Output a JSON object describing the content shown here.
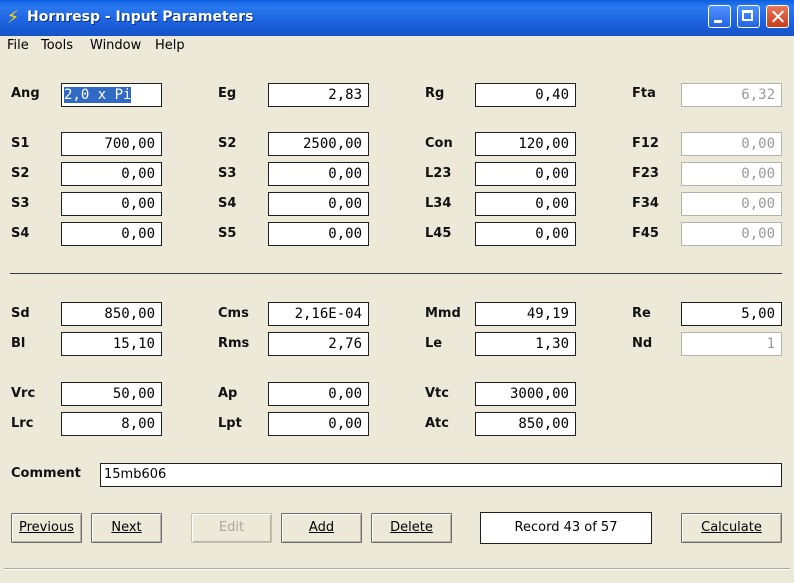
{
  "window": {
    "title": "Hornresp - Input Parameters"
  },
  "menu": [
    "File",
    "Tools",
    "Window",
    "Help"
  ],
  "fields": {
    "Ang": "2,0 x Pi",
    "Eg": "2,83",
    "Rg": "0,40",
    "Fta": "6,32",
    "S1": "700,00",
    "S2a": "2500,00",
    "Con": "120,00",
    "F12": "0,00",
    "S2": "0,00",
    "S3a": "0,00",
    "L23": "0,00",
    "F23": "0,00",
    "S3": "0,00",
    "S4a": "0,00",
    "L34": "0,00",
    "F34": "0,00",
    "S4": "0,00",
    "S5": "0,00",
    "L45": "0,00",
    "F45": "0,00",
    "Sd": "850,00",
    "Cms": "2,16E-04",
    "Mmd": "49,19",
    "Re": "5,00",
    "Bl": "15,10",
    "Rms": "2,76",
    "Le": "1,30",
    "Nd": "1",
    "Vrc": "50,00",
    "Ap": "0,00",
    "Vtc": "3000,00",
    "Lrc": "8,00",
    "Lpt": "0,00",
    "Atc": "850,00"
  },
  "labels": {
    "Ang": "Ang",
    "Eg": "Eg",
    "Rg": "Rg",
    "Fta": "Fta",
    "S1": "S1",
    "S2a": "S2",
    "Con": "Con",
    "F12": "F12",
    "S2": "S2",
    "S3a": "S3",
    "L23": "L23",
    "F23": "F23",
    "S3": "S3",
    "S4a": "S4",
    "L34": "L34",
    "F34": "F34",
    "S4": "S4",
    "S5": "S5",
    "L45": "L45",
    "F45": "F45",
    "Sd": "Sd",
    "Cms": "Cms",
    "Mmd": "Mmd",
    "Re": "Re",
    "Bl": "Bl",
    "Rms": "Rms",
    "Le": "Le",
    "Nd": "Nd",
    "Vrc": "Vrc",
    "Ap": "Ap",
    "Vtc": "Vtc",
    "Lrc": "Lrc",
    "Lpt": "Lpt",
    "Atc": "Atc",
    "Comment": "Comment"
  },
  "comment": "15mb606",
  "buttons": {
    "previous": "Previous",
    "next": "Next",
    "edit": "Edit",
    "add": "Add",
    "delete": "Delete",
    "calculate": "Calculate"
  },
  "record": "Record 43 of 57"
}
